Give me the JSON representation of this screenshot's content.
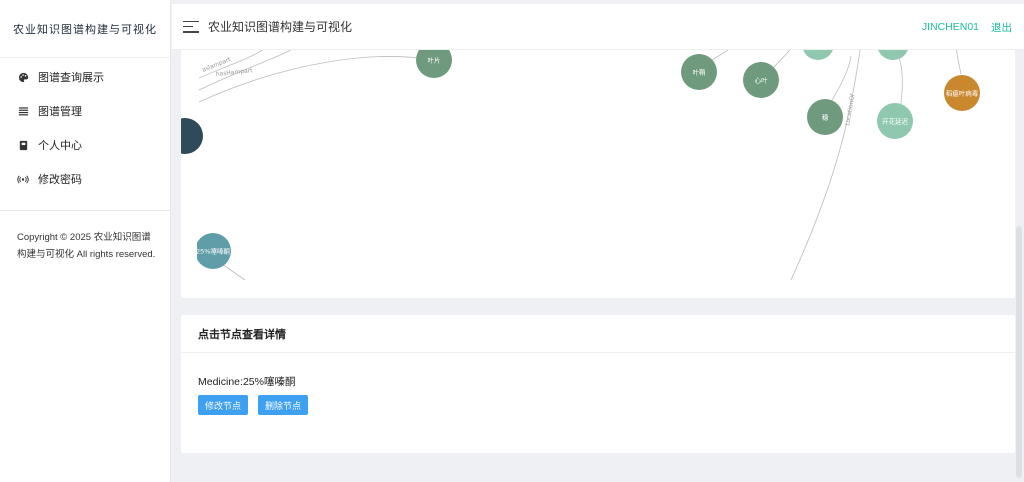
{
  "app": {
    "brand": "农业知识图谱构建与可视化",
    "title": "农业知识图谱构建与可视化",
    "user": "JINCHEN01",
    "logout": "退出"
  },
  "sidebar": {
    "items": [
      {
        "label": "图谱查询展示",
        "icon": "palette-icon"
      },
      {
        "label": "图谱管理",
        "icon": "list-icon"
      },
      {
        "label": "个人中心",
        "icon": "book-icon"
      },
      {
        "label": "修改密码",
        "icon": "broadcast-icon"
      }
    ],
    "copyright": "Copyright © 2025 农业知识图谱构建与可视化 All rights reserved."
  },
  "graph": {
    "nodes": [
      {
        "label": "叶片",
        "color": "#6f9a7e"
      },
      {
        "label": "叶鞘",
        "color": "#6f9a7e"
      },
      {
        "label": "心叶",
        "color": "#6f9a7e"
      },
      {
        "label": "穗",
        "color": "#6f9a7e"
      },
      {
        "label": "开花延迟",
        "color": "#8fc8ae"
      },
      {
        "label": "稻瘟叶病毒",
        "color": "#c9872e"
      },
      {
        "label": "25%噻嗪酮",
        "color": "#5f9ea8"
      }
    ],
    "edge_labels": [
      "aslampart",
      "hasHampart",
      "LocationOf"
    ]
  },
  "detail": {
    "heading": "点击节点查看详情",
    "info": "Medicine:25%噻嗪酮",
    "edit_label": "修改节点",
    "delete_label": "删除节点"
  }
}
